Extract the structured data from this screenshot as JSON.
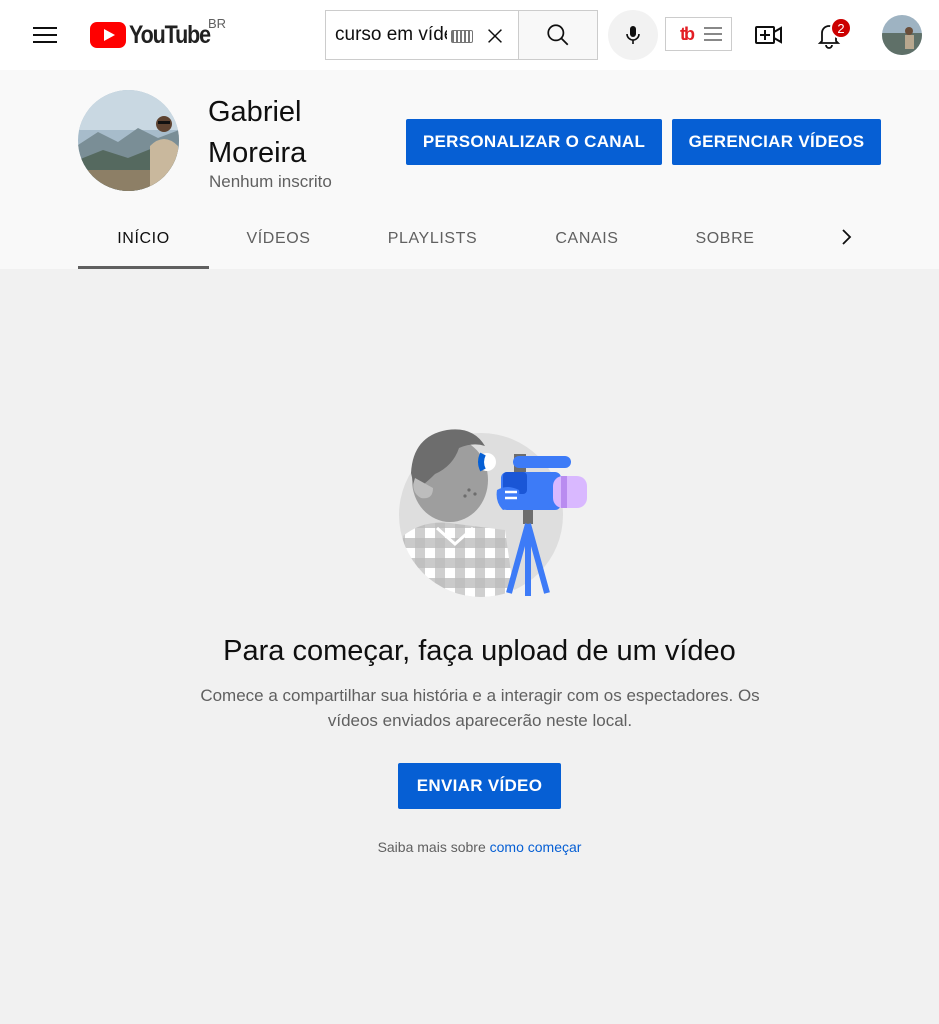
{
  "topbar": {
    "logo_text": "YouTube",
    "country_code": "BR",
    "search_value": "curso em vídeo",
    "notifications_count": "2"
  },
  "channel": {
    "name": "Gabriel Moreira",
    "subscribers": "Nenhum inscrito",
    "customize_label": "PERSONALIZAR O CANAL",
    "manage_label": "GERENCIAR VÍDEOS"
  },
  "tabs": [
    {
      "label": "INÍCIO",
      "active": true
    },
    {
      "label": "VÍDEOS",
      "active": false
    },
    {
      "label": "PLAYLISTS",
      "active": false
    },
    {
      "label": "CANAIS",
      "active": false
    },
    {
      "label": "SOBRE",
      "active": false
    }
  ],
  "empty_state": {
    "title": "Para começar, faça upload de um vídeo",
    "description": "Comece a compartilhar sua história e a interagir com os espectadores. Os vídeos enviados aparecerão neste local.",
    "upload_label": "ENVIAR VÍDEO",
    "learn_more_prefix": "Saiba mais sobre",
    "learn_more_link": "como começar"
  },
  "colors": {
    "brand_red": "#ff0000",
    "action_blue": "#065fd4",
    "badge_red": "#cc0000"
  },
  "icons": [
    "menu-icon",
    "youtube-logo-icon",
    "keyboard-icon",
    "clear-icon",
    "search-icon",
    "microphone-icon",
    "tubebuddy-icon",
    "create-video-icon",
    "bell-icon",
    "chevron-right-icon"
  ]
}
